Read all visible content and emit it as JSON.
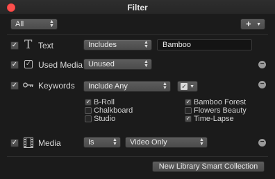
{
  "window": {
    "title": "Filter"
  },
  "match_popup": {
    "value": "All"
  },
  "add_rule_label": "+",
  "rules": {
    "text": {
      "label": "Text",
      "operator": "Includes",
      "value": "Bamboo"
    },
    "used_media": {
      "label": "Used Media",
      "value": "Unused"
    },
    "keywords": {
      "label": "Keywords",
      "operator": "Include Any",
      "checkbox_mark": "✓",
      "items": [
        {
          "label": "B-Roll",
          "checked": true
        },
        {
          "label": "Chalkboard",
          "checked": false
        },
        {
          "label": "Studio",
          "checked": false
        },
        {
          "label": "Bamboo Forest",
          "checked": true
        },
        {
          "label": "Flowers Beauty",
          "checked": false
        },
        {
          "label": "Time-Lapse",
          "checked": true
        }
      ]
    },
    "media": {
      "label": "Media",
      "operator": "Is",
      "value": "Video Only"
    }
  },
  "footer": {
    "new_collection_label": "New Library Smart Collection"
  },
  "colors": {
    "close": "#fb4f4c",
    "background": "#1b1b1b"
  }
}
